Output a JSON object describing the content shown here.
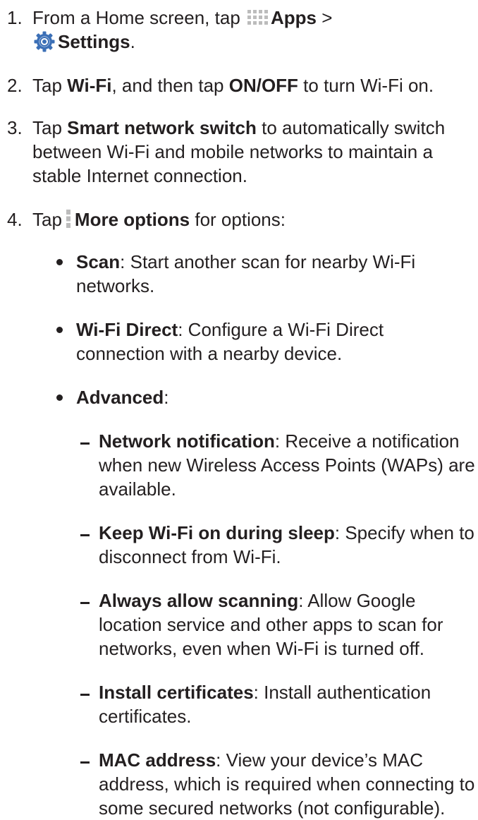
{
  "steps": [
    {
      "number": "1.",
      "lines": [
        {
          "pre": "From a Home screen, tap",
          "bold": "Apps",
          "post": " >"
        },
        {
          "bold": "Settings",
          "post": "."
        }
      ]
    },
    {
      "number": "2.",
      "text": {
        "a": "Tap ",
        "b1": "Wi-Fi",
        "c": ", and then tap ",
        "b2": "ON/OFF",
        "d": " to turn Wi-Fi on."
      }
    },
    {
      "number": "3.",
      "text": {
        "a": "Tap ",
        "b1": "Smart network switch",
        "c": " to automatically switch between Wi-Fi and mobile networks to maintain a stable Internet connection."
      }
    },
    {
      "number": "4.",
      "text": {
        "a": "Tap",
        "b1": "More options",
        "c": " for options:"
      }
    }
  ],
  "bullets": [
    {
      "term": "Scan",
      "desc": ": Start another scan for nearby Wi-Fi networks."
    },
    {
      "term": "Wi-Fi Direct",
      "desc": ": Configure a Wi-Fi Direct connection with a nearby device."
    },
    {
      "term": "Advanced",
      "desc": ":"
    }
  ],
  "subitems": [
    {
      "term": "Network notification",
      "desc": ": Receive a notification when new Wireless Access Points (WAPs) are available."
    },
    {
      "term": "Keep Wi-Fi on during sleep",
      "desc": ": Specify when to disconnect from Wi-Fi."
    },
    {
      "term": "Always allow scanning",
      "desc": ": Allow Google location service and other apps to scan for networks, even when Wi-Fi is turned off."
    },
    {
      "term": "Install certificates",
      "desc": ": Install authentication certificates."
    },
    {
      "term": "MAC address",
      "desc": ": View your device’s MAC address, which is required when connecting to some secured networks (not configurable)."
    }
  ],
  "colors": {
    "text": "#231f20",
    "icon_grey": "#bcbcbc",
    "gear_blue": "#3b6fb6",
    "gear_ring": "#f3c15a"
  },
  "icons": [
    "apps-grid-icon",
    "settings-gear-icon",
    "more-options-icon"
  ]
}
